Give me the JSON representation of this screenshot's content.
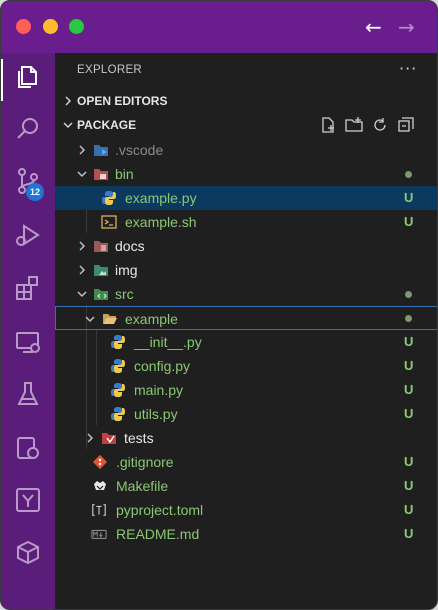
{
  "window": {
    "colors": {
      "titlebar": "#6a1e8e",
      "activitybar": "#5a1e7a",
      "sidebar": "#1f1f1f",
      "selection": "#0b3a5e",
      "untracked": "#8bc873"
    }
  },
  "titlebar": {
    "back_icon": "arrow-left-icon",
    "forward_icon": "arrow-right-icon",
    "back_glyph": "←",
    "forward_glyph": "→"
  },
  "activitybar": {
    "items": [
      {
        "name": "explorer",
        "icon": "files-icon",
        "active": true
      },
      {
        "name": "search",
        "icon": "search-icon"
      },
      {
        "name": "source-control",
        "icon": "source-control-icon",
        "badge": "12"
      },
      {
        "name": "run-debug",
        "icon": "run-debug-icon"
      },
      {
        "name": "extensions",
        "icon": "extensions-icon"
      },
      {
        "name": "remote-explorer",
        "icon": "remote-explorer-icon"
      },
      {
        "name": "testing",
        "icon": "beaker-icon"
      },
      {
        "name": "gitlens",
        "icon": "gitlens-icon"
      },
      {
        "name": "source-graph",
        "icon": "branch-graph-icon"
      },
      {
        "name": "containers",
        "icon": "container-icon"
      }
    ]
  },
  "sidebar": {
    "title": "EXPLORER",
    "more_label": "···",
    "sections": {
      "open_editors": "OPEN EDITORS",
      "package": "PACKAGE"
    },
    "package_actions": [
      "new-file-icon",
      "new-folder-icon",
      "refresh-icon",
      "collapse-all-icon"
    ]
  },
  "tree": [
    {
      "label": ".vscode",
      "kind": "folder",
      "expanded": false,
      "status": "",
      "icon": "vscode-folder-icon"
    },
    {
      "label": "bin",
      "kind": "folder",
      "expanded": true,
      "status": "dot",
      "icon": "bin-folder-icon"
    },
    {
      "label": "example.py",
      "kind": "file",
      "status": "U",
      "icon": "python-icon",
      "selected": true
    },
    {
      "label": "example.sh",
      "kind": "file",
      "status": "U",
      "icon": "shell-icon"
    },
    {
      "label": "docs",
      "kind": "folder",
      "expanded": false,
      "status": "",
      "icon": "docs-folder-icon"
    },
    {
      "label": "img",
      "kind": "folder",
      "expanded": false,
      "status": "",
      "icon": "img-folder-icon"
    },
    {
      "label": "src",
      "kind": "folder",
      "expanded": true,
      "status": "dot",
      "icon": "src-folder-icon"
    },
    {
      "label": "example",
      "kind": "folder",
      "expanded": true,
      "status": "dot",
      "icon": "folder-open-icon",
      "focused": true
    },
    {
      "label": "__init__.py",
      "kind": "file",
      "status": "U",
      "icon": "python-icon"
    },
    {
      "label": "config.py",
      "kind": "file",
      "status": "U",
      "icon": "python-icon"
    },
    {
      "label": "main.py",
      "kind": "file",
      "status": "U",
      "icon": "python-icon"
    },
    {
      "label": "utils.py",
      "kind": "file",
      "status": "U",
      "icon": "python-icon"
    },
    {
      "label": "tests",
      "kind": "folder",
      "expanded": false,
      "status": "",
      "icon": "tests-folder-icon"
    },
    {
      "label": ".gitignore",
      "kind": "file",
      "status": "U",
      "icon": "git-icon"
    },
    {
      "label": "Makefile",
      "kind": "file",
      "status": "U",
      "icon": "makefile-icon"
    },
    {
      "label": "pyproject.toml",
      "kind": "file",
      "status": "U",
      "icon": "toml-icon"
    },
    {
      "label": "README.md",
      "kind": "file",
      "status": "U",
      "icon": "markdown-icon"
    }
  ]
}
